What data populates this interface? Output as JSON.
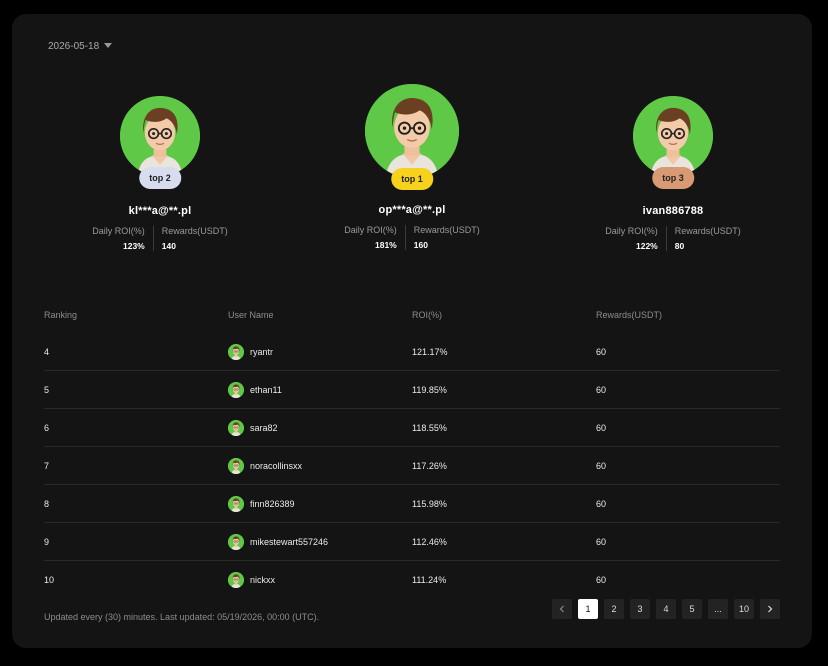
{
  "date_filter": "2026-05-18",
  "podium": [
    {
      "badge": "top 2",
      "name": "kl***a@**.pl",
      "roi_label": "Daily ROI(%)",
      "roi": "123%",
      "reward_label": "Rewards(USDT)",
      "reward": "140",
      "badge_color": "#d8dcef"
    },
    {
      "badge": "top 1",
      "name": "op***a@**.pl",
      "roi_label": "Daily ROI(%)",
      "roi": "181%",
      "reward_label": "Rewards(USDT)",
      "reward": "160",
      "badge_color": "#f7d21c"
    },
    {
      "badge": "top 3",
      "name": "ivan886788",
      "roi_label": "Daily ROI(%)",
      "roi": "122%",
      "reward_label": "Rewards(USDT)",
      "reward": "80",
      "badge_color": "#d89a72"
    }
  ],
  "table": {
    "headers": [
      "Ranking",
      "User Name",
      "ROI(%)",
      "Rewards(USDT)"
    ],
    "rows": [
      {
        "rank": "4",
        "user": "ryantr",
        "roi": "121.17%",
        "reward": "60"
      },
      {
        "rank": "5",
        "user": "ethan11",
        "roi": "119.85%",
        "reward": "60"
      },
      {
        "rank": "6",
        "user": "sara82",
        "roi": "118.55%",
        "reward": "60"
      },
      {
        "rank": "7",
        "user": "noracollinsxx",
        "roi": "117.26%",
        "reward": "60"
      },
      {
        "rank": "8",
        "user": "finn826389",
        "roi": "115.98%",
        "reward": "60"
      },
      {
        "rank": "9",
        "user": "mikestewart557246",
        "roi": "112.46%",
        "reward": "60"
      },
      {
        "rank": "10",
        "user": "nickxx",
        "roi": "111.24%",
        "reward": "60"
      }
    ]
  },
  "footer_note": "Updated every (30) minutes. Last updated: 05/19/2026, 00:00 (UTC).",
  "pagination": {
    "prev_icon": "chevron-left-icon",
    "pages": [
      "1",
      "2",
      "3",
      "4",
      "5",
      "...",
      "10"
    ],
    "active": "1",
    "next_icon": "chevron-right-icon"
  },
  "colors": {
    "avatar_bg": "#5fc846",
    "panel_bg": "#141414"
  }
}
